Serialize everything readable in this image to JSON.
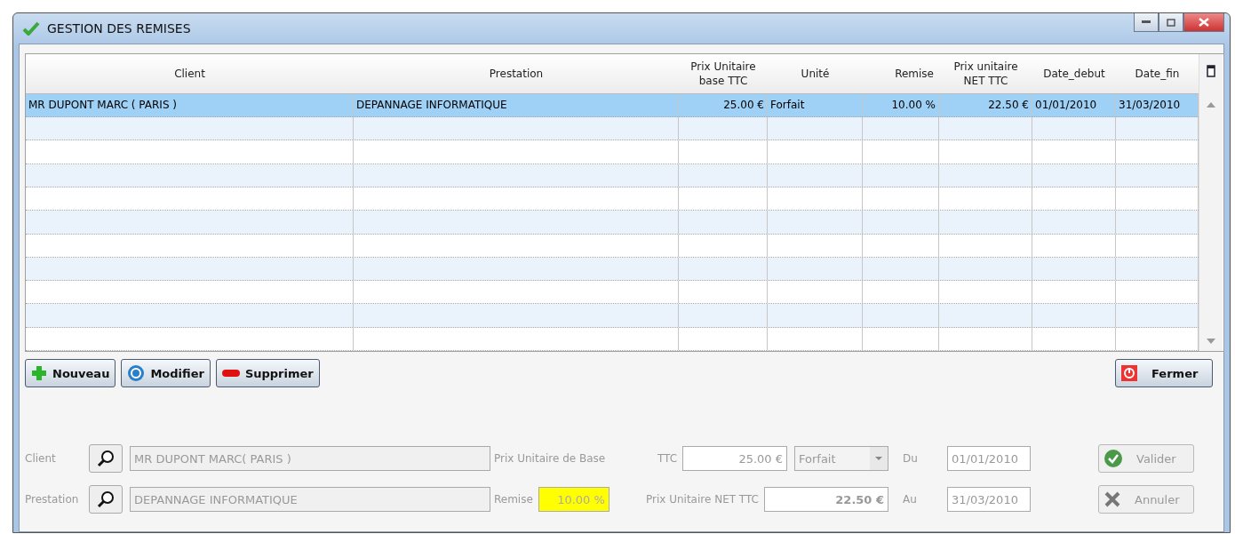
{
  "window": {
    "title": "GESTION DES REMISES"
  },
  "table": {
    "columns": [
      "Client",
      "Prestation",
      "Prix Unitaire base TTC",
      "Unité",
      "Remise",
      "Prix unitaire NET TTC",
      "Date_debut",
      "Date_fin"
    ],
    "rows": [
      {
        "selected": true,
        "cells": [
          "MR DUPONT MARC ( PARIS )",
          "DEPANNAGE INFORMATIQUE",
          "25.00 €",
          "Forfait",
          "10.00 %",
          "22.50 €",
          "01/01/2010",
          "31/03/2010"
        ]
      }
    ]
  },
  "actions": [
    {
      "kind": "add",
      "label": "Nouveau"
    },
    {
      "kind": "edit",
      "label": "Modifier"
    },
    {
      "kind": "delete",
      "label": "Supprimer"
    }
  ],
  "close_button": {
    "label": "Fermer"
  },
  "form": {
    "client": {
      "label": "Client",
      "value": "MR DUPONT MARC( PARIS )",
      "disabled": true
    },
    "prestation": {
      "label": "Prestation",
      "value": "DEPANNAGE INFORMATIQUE",
      "disabled": true
    },
    "base_price": {
      "label": "Prix Unitaire de Base",
      "suffix": "TTC",
      "value": "25.00 €"
    },
    "unit": {
      "value": "Forfait",
      "disabled": true
    },
    "discount": {
      "label": "Remise",
      "value": "10.00 %",
      "highlighted": true
    },
    "net_price": {
      "label": "Prix Unitaire NET TTC",
      "value": "22.50 €"
    },
    "from": {
      "label": "Du",
      "value": "01/01/2010"
    },
    "to": {
      "label": "Au",
      "value": "31/03/2010"
    },
    "buttons": [
      {
        "kind": "validate",
        "label": "Valider",
        "disabled": true
      },
      {
        "kind": "cancel",
        "label": "Annuler",
        "disabled": true
      }
    ]
  }
}
